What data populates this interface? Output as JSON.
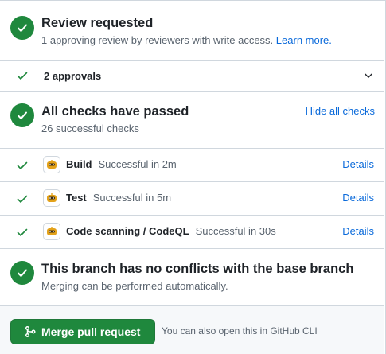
{
  "review": {
    "title": "Review requested",
    "subtitle": "1 approving review by reviewers with write access.",
    "learn_more": "Learn more."
  },
  "approvals": {
    "label": "2 approvals"
  },
  "checks": {
    "title": "All checks have passed",
    "subtitle": "26 successful checks",
    "hide_link": "Hide all checks",
    "items": [
      {
        "name": "Build",
        "status": "Successful in 2m",
        "details": "Details",
        "icon": "github-actions-bot-icon"
      },
      {
        "name": "Test",
        "status": "Successful in 5m",
        "details": "Details",
        "icon": "github-actions-bot-icon"
      },
      {
        "name": "Code scanning / CodeQL",
        "status": "Successful in 30s",
        "details": "Details",
        "icon": "github-actions-bot-icon"
      }
    ]
  },
  "conflicts": {
    "title": "This branch has no conflicts with the base branch",
    "subtitle": "Merging can be performed automatically."
  },
  "merge": {
    "button_label": "Merge pull request",
    "cli_note": "You can also open this in GitHub CLI"
  },
  "colors": {
    "success": "#1f883d",
    "link": "#0969da",
    "muted": "#59636e",
    "border": "#d0d7de"
  }
}
